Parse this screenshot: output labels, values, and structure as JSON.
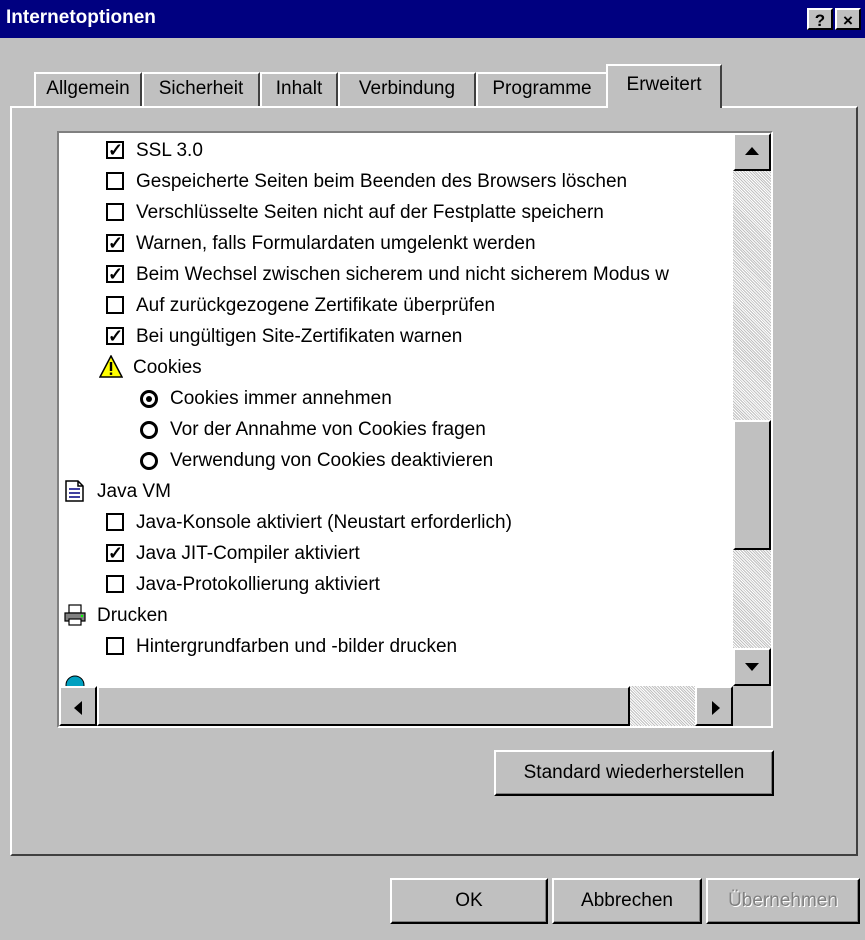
{
  "window": {
    "title": "Internetoptionen",
    "help_label": "?",
    "close_label": "×"
  },
  "tabs": [
    {
      "label": "Allgemein"
    },
    {
      "label": "Sicherheit"
    },
    {
      "label": "Inhalt"
    },
    {
      "label": "Verbindung"
    },
    {
      "label": "Programme"
    },
    {
      "label": "Erweitert",
      "active": true
    }
  ],
  "settings_list": [
    {
      "type": "checkbox",
      "checked": true,
      "label": "SSL 3.0"
    },
    {
      "type": "checkbox",
      "checked": false,
      "label": "Gespeicherte Seiten beim Beenden des Browsers löschen"
    },
    {
      "type": "checkbox",
      "checked": false,
      "label": "Verschlüsselte Seiten nicht auf der Festplatte speichern"
    },
    {
      "type": "checkbox",
      "checked": true,
      "label": "Warnen, falls Formulardaten umgelenkt werden"
    },
    {
      "type": "checkbox",
      "checked": true,
      "label": "Beim Wechsel zwischen sicherem und nicht sicherem Modus w"
    },
    {
      "type": "checkbox",
      "checked": false,
      "label": "Auf zurückgezogene Zertifikate überprüfen"
    },
    {
      "type": "checkbox",
      "checked": true,
      "label": "Bei ungültigen Site-Zertifikaten warnen"
    },
    {
      "type": "category",
      "icon": "warning-icon",
      "label": "Cookies"
    },
    {
      "type": "radio",
      "checked": true,
      "label": "Cookies immer annehmen"
    },
    {
      "type": "radio",
      "checked": false,
      "label": "Vor der Annahme von Cookies fragen"
    },
    {
      "type": "radio",
      "checked": false,
      "label": "Verwendung von Cookies deaktivieren"
    },
    {
      "type": "category",
      "icon": "document-icon",
      "label": "Java VM"
    },
    {
      "type": "checkbox",
      "checked": false,
      "label": "Java-Konsole aktiviert (Neustart erforderlich)"
    },
    {
      "type": "checkbox",
      "checked": true,
      "label": "Java JIT-Compiler aktiviert"
    },
    {
      "type": "checkbox",
      "checked": false,
      "label": "Java-Protokollierung aktiviert"
    },
    {
      "type": "category",
      "icon": "printer-icon",
      "label": "Drucken"
    },
    {
      "type": "checkbox",
      "checked": false,
      "label": "Hintergrundfarben und -bilder drucken"
    }
  ],
  "buttons": {
    "restore_defaults": "Standard wiederherstellen",
    "ok": "OK",
    "cancel": "Abbrechen",
    "apply": "Übernehmen"
  },
  "colors": {
    "titlebar": "#000080",
    "face": "#c0c0c0",
    "warning": "#ffff00"
  }
}
